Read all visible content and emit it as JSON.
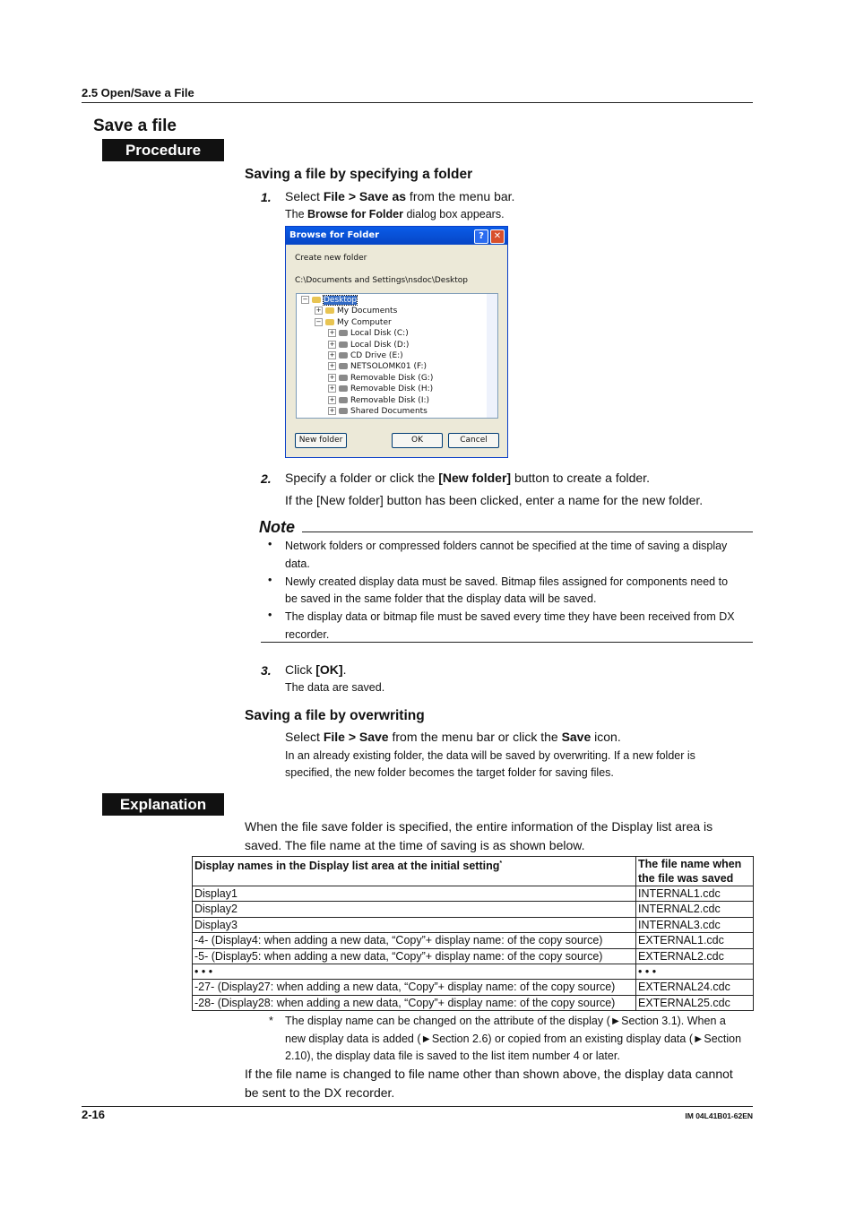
{
  "header": {
    "section": "2.5  Open/Save a File"
  },
  "title": "Save a file",
  "procedure_label": "Procedure",
  "sub1": {
    "heading": "Saving a file by specifying a folder",
    "step1": {
      "num": "1.",
      "pre": "Select ",
      "b1": "File > Save as",
      "post": " from the menu bar.",
      "sub_pre": "The ",
      "sub_b": "Browse for Folder",
      "sub_post": " dialog box appears."
    },
    "step2": {
      "num": "2.",
      "pre": "Specify a folder or click the ",
      "b": "[New folder]",
      "post": " button to create a folder.",
      "sub": "If the [New folder] button has been clicked, enter a name for the new folder."
    },
    "step3": {
      "num": "3.",
      "pre": "Click ",
      "b": "[OK]",
      "post": ".",
      "sub": "The data are saved."
    }
  },
  "dialog": {
    "title": "Browse for Folder",
    "help": "?",
    "close": "✕",
    "caption": "Create new folder",
    "path": "C:\\Documents and Settings\\nsdoc\\Desktop",
    "tree": [
      {
        "label": "Desktop",
        "level": 0,
        "exp": "−",
        "sel": true
      },
      {
        "label": "My Documents",
        "level": 1,
        "exp": "+"
      },
      {
        "label": "My Computer",
        "level": 1,
        "exp": "−"
      },
      {
        "label": "Local Disk (C:)",
        "level": 2,
        "exp": "+"
      },
      {
        "label": "Local Disk (D:)",
        "level": 2,
        "exp": "+"
      },
      {
        "label": "CD Drive (E:)",
        "level": 2,
        "exp": "+"
      },
      {
        "label": "NETSOLOMK01 (F:)",
        "level": 2,
        "exp": "+"
      },
      {
        "label": "Removable Disk (G:)",
        "level": 2,
        "exp": "+"
      },
      {
        "label": "Removable Disk (H:)",
        "level": 2,
        "exp": "+"
      },
      {
        "label": "Removable Disk (I:)",
        "level": 2,
        "exp": "+"
      },
      {
        "label": "Shared Documents",
        "level": 2,
        "exp": "+"
      }
    ],
    "new_folder": "New folder",
    "ok": "OK",
    "cancel": "Cancel"
  },
  "note": {
    "title": "Note",
    "bullet": "•",
    "items": [
      [
        "Network folders or compressed folders cannot be specified at the time of saving a display",
        "data."
      ],
      [
        "Newly created display data must be saved. Bitmap files assigned for components need to",
        "be saved in the same folder that the display data will be saved."
      ],
      [
        "The display data or bitmap file must be saved every time they have been received from DX",
        "recorder."
      ]
    ]
  },
  "sub2": {
    "heading": "Saving a file by overwriting",
    "pre": "Select ",
    "b1": "File > Save",
    "mid": " from the menu bar or click the ",
    "b2": "Save",
    "post": " icon.",
    "l1": "In an already existing folder, the data will be saved by overwriting. If a new folder is",
    "l2": "specified, the new folder becomes the target folder for saving files."
  },
  "explanation_label": "Explanation",
  "exp": {
    "l1": "When the file save folder is specified, the entire information of the Display list area is",
    "l2": "saved. The file name at the time of saving is as shown below."
  },
  "table": {
    "headers": [
      "Display names in the Display list area at the initial setting",
      "The file name when",
      "the file was saved"
    ],
    "star": "*",
    "rows": [
      [
        "Display1",
        "INTERNAL1.cdc"
      ],
      [
        "Display2",
        "INTERNAL2.cdc"
      ],
      [
        "Display3",
        "INTERNAL3.cdc"
      ],
      [
        "-4- (Display4: when adding a new data, “Copy”+ display name: of the copy source)",
        "EXTERNAL1.cdc"
      ],
      [
        "-5- (Display5: when adding a new data, “Copy”+ display name: of the copy source)",
        "EXTERNAL2.cdc"
      ],
      [
        "• • •",
        "• • •"
      ],
      [
        "-27- (Display27: when adding a new data, “Copy”+ display name: of the copy source)",
        "EXTERNAL24.cdc"
      ],
      [
        "-28- (Display28: when adding a new data, “Copy”+ display name: of the copy source)",
        "EXTERNAL25.cdc"
      ]
    ]
  },
  "footnote": {
    "mark": "*",
    "l1": "The display name can be changed on the attribute of the display (►Section 3.1). When a",
    "l2": "new display data is added (►Section 2.6) or copied from an existing display data (►Section",
    "l3": "2.10), the display data file is saved to the list item number 4 or later."
  },
  "closing": {
    "l1": "If the file name is changed to file name other than shown above, the display data cannot",
    "l2": "be sent to the DX recorder."
  },
  "footer": {
    "page": "2-16",
    "doc": "IM 04L41B01-62EN"
  }
}
